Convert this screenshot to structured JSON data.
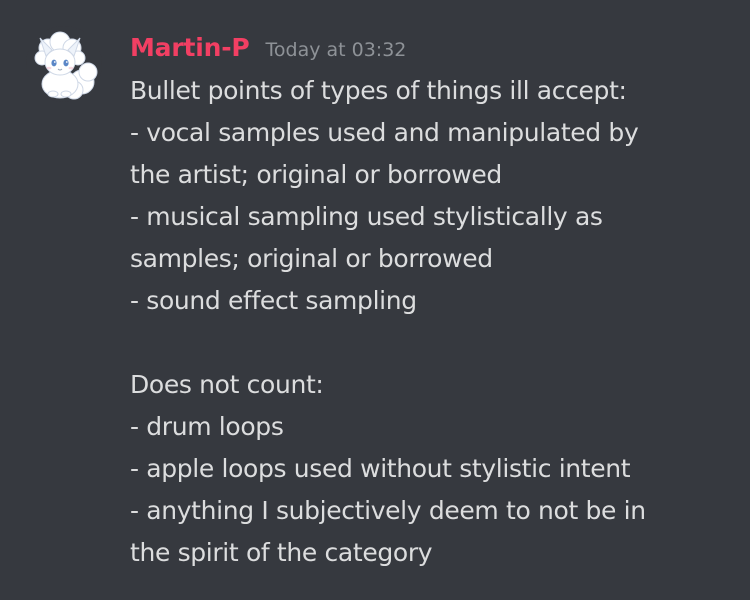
{
  "message": {
    "author": {
      "name": "Martin-P",
      "name_color": "#f23f63",
      "avatar": "white-vulpix-icon"
    },
    "timestamp": "Today at 03:32",
    "timestamp_color": "#8e9297",
    "text_color": "#dcddde",
    "lines": [
      "Bullet points of types of things ill accept:",
      "- vocal samples used and manipulated by",
      "the artist; original or borrowed",
      "- musical sampling used stylistically as",
      "samples; original or borrowed",
      "- sound effect sampling",
      "",
      "Does not count:",
      "- drum loops",
      "- apple loops used without stylistic intent",
      "- anything I subjectively deem to not be in",
      "the spirit of the category"
    ]
  },
  "background_color": "#36393f"
}
